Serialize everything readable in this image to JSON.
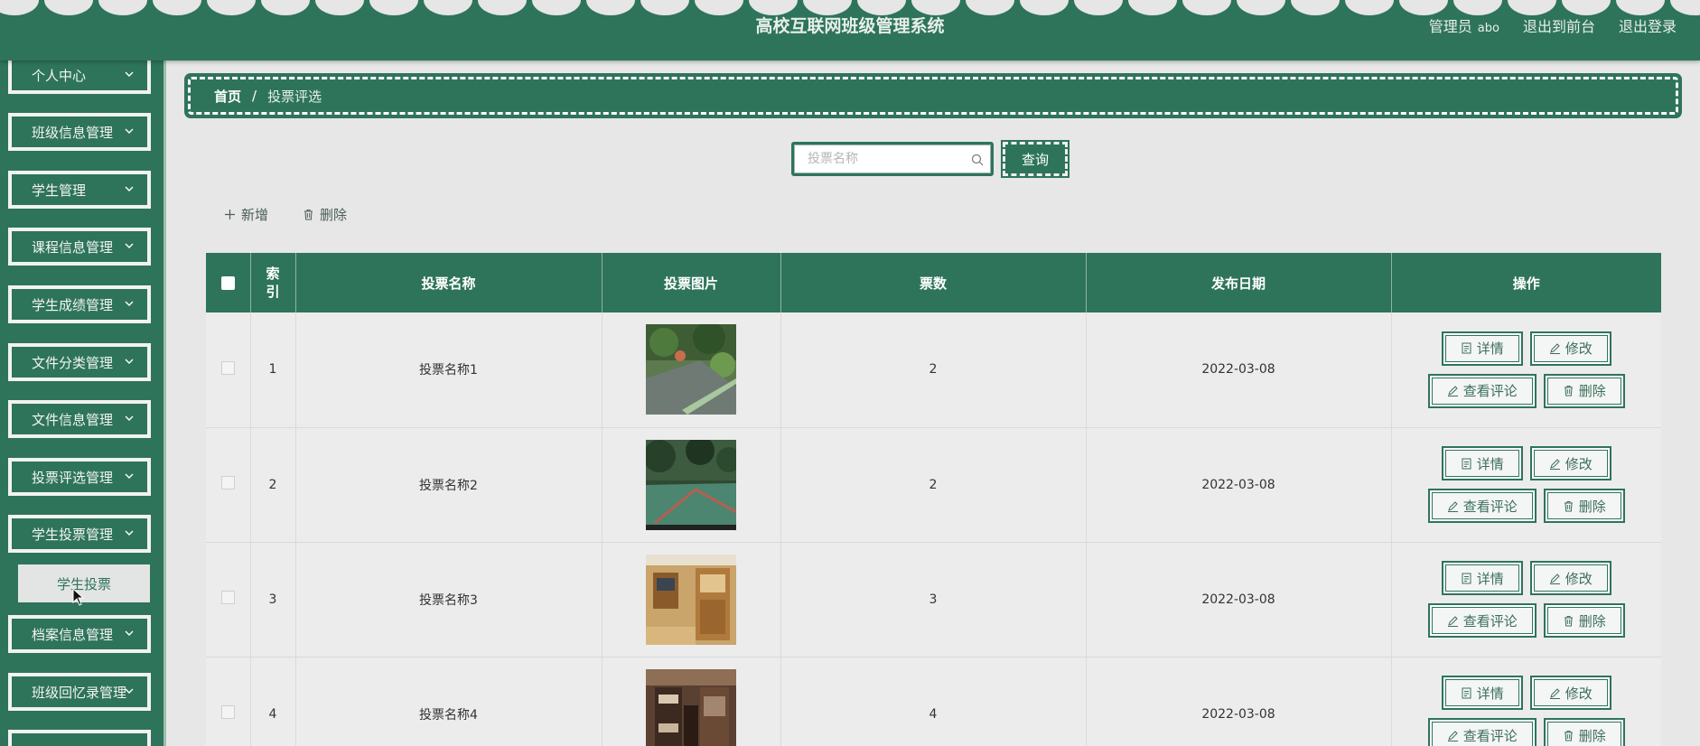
{
  "header": {
    "title": "高校互联网班级管理系统",
    "role_label": "管理员",
    "user_name": "abo",
    "to_front": "退出到前台",
    "logout": "退出登录"
  },
  "sidebar": {
    "items": [
      {
        "label": "个人中心"
      },
      {
        "label": "班级信息管理"
      },
      {
        "label": "学生管理"
      },
      {
        "label": "课程信息管理"
      },
      {
        "label": "学生成绩管理"
      },
      {
        "label": "文件分类管理"
      },
      {
        "label": "文件信息管理"
      },
      {
        "label": "投票评选管理"
      },
      {
        "label": "学生投票管理"
      },
      {
        "label": "档案信息管理"
      },
      {
        "label": "班级回忆录管理"
      }
    ],
    "submenu": {
      "label": "学生投票"
    }
  },
  "breadcrumb": {
    "home": "首页",
    "separator": "/",
    "current": "投票评选"
  },
  "search": {
    "placeholder": "投票名称",
    "button": "查询"
  },
  "toolbar": {
    "add": "新增",
    "delete": "删除"
  },
  "table": {
    "headers": {
      "index": "索\n引",
      "name": "投票名称",
      "image": "投票图片",
      "votes": "票数",
      "date": "发布日期",
      "ops": "操作"
    },
    "rows": [
      {
        "index": "1",
        "name": "投票名称1",
        "image_desc": "campus-garden-photo",
        "votes": "2",
        "date": "2022-03-08"
      },
      {
        "index": "2",
        "name": "投票名称2",
        "image_desc": "basketball-court-photo",
        "votes": "2",
        "date": "2022-03-08"
      },
      {
        "index": "3",
        "name": "投票名称3",
        "image_desc": "dorm-room-photo",
        "votes": "3",
        "date": "2022-03-08"
      },
      {
        "index": "4",
        "name": "投票名称4",
        "image_desc": "bunk-bed-room-photo",
        "votes": "4",
        "date": "2022-03-08"
      }
    ],
    "actions": {
      "detail": "详情",
      "edit": "修改",
      "comments": "查看评论",
      "delete": "删除"
    }
  },
  "colors": {
    "primary": "#2e745b",
    "background": "#e7e7e7",
    "row": "#ececec"
  }
}
